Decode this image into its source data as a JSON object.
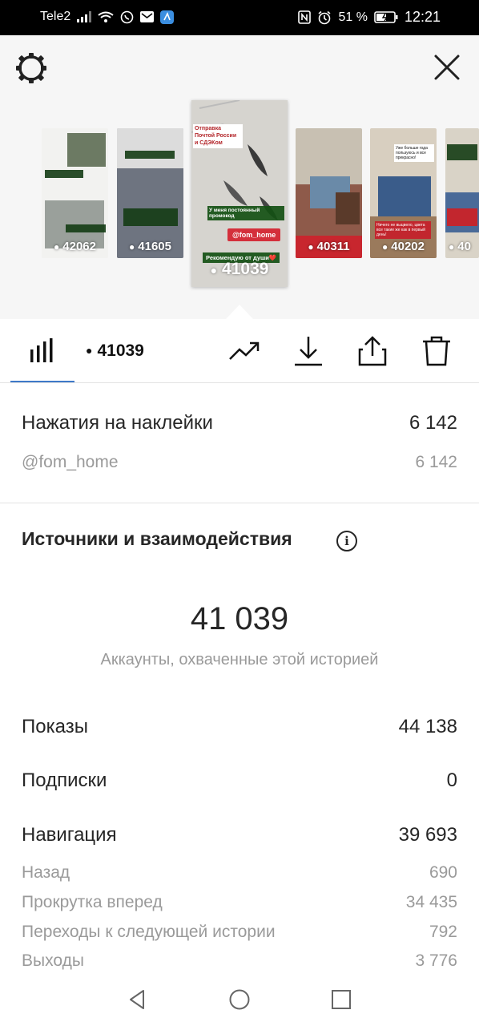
{
  "status_bar": {
    "carrier": "Tele2",
    "battery": "51 %",
    "time": "12:21"
  },
  "icons": {
    "settings": "settings-icon",
    "close": "close-icon",
    "stats": "bar-chart-icon",
    "promote": "trending-up-icon",
    "download": "download-icon",
    "share": "share-icon",
    "delete": "trash-icon"
  },
  "stories": [
    {
      "views": "42062"
    },
    {
      "views": "41605"
    },
    {
      "views": "41039",
      "title": "Отправка Почтой России и СДЭКом",
      "promo": "У меня постоянный промокод",
      "handle": "@fom_home",
      "reco": "Рекомендую от души❤️"
    },
    {
      "views": "40311"
    },
    {
      "views": "40202",
      "caption": "Уже больше года пользуюсь и все прекрасно!",
      "caption2": "Ничего не выцвело, цвета все такие же как в первый день!"
    },
    {
      "views": "40"
    }
  ],
  "toolbar": {
    "views": "41039"
  },
  "sticker_taps": {
    "label": "Нажатия на наклейки",
    "value": "6 142",
    "items": [
      {
        "label": "@fom_home",
        "value": "6 142"
      }
    ]
  },
  "sources": {
    "title": "Источники и взаимодействия",
    "info_glyph": "i",
    "reach_value": "41 039",
    "reach_label": "Аккаунты, охваченные этой историей",
    "impressions": {
      "label": "Показы",
      "value": "44 138"
    },
    "follows": {
      "label": "Подписки",
      "value": "0"
    },
    "navigation": {
      "label": "Навигация",
      "value": "39 693",
      "items": [
        {
          "label": "Назад",
          "value": "690"
        },
        {
          "label": "Прокрутка вперед",
          "value": "34 435"
        },
        {
          "label": "Переходы к следующей истории",
          "value": "792"
        },
        {
          "label": "Выходы",
          "value": "3 776"
        }
      ]
    }
  },
  "colors": {
    "accent_underline": "#3e79c8",
    "handle_red": "#d42f3b",
    "text_primary": "#262626",
    "text_secondary": "#9a9a9a"
  }
}
